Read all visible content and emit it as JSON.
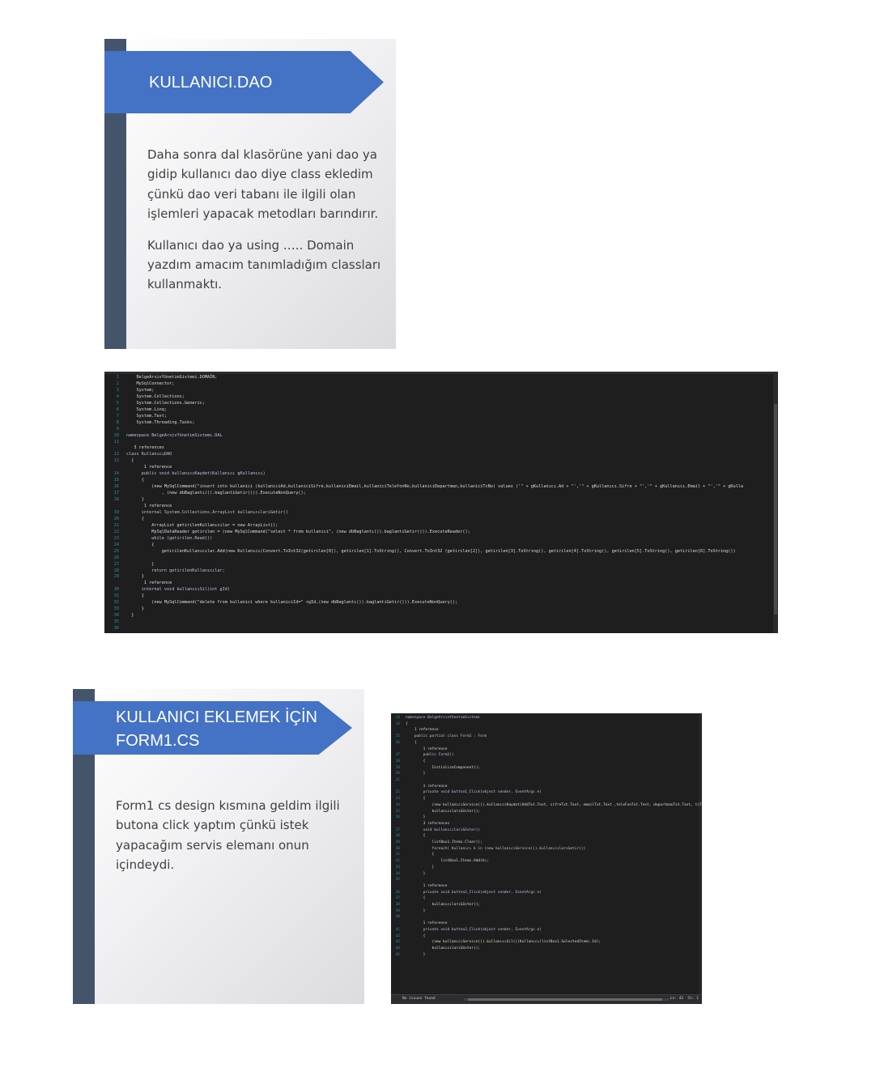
{
  "slide1": {
    "title": "KULLANICI.DAO",
    "paragraph1": "Daha sonra dal klasörüne yani dao ya gidip kullanıcı dao diye class ekledim çünkü dao veri tabanı ile ilgili olan işlemleri yapacak metodları barındırır.",
    "paragraph2": "Kullanıcı dao ya using ….. Domain yazdım amacım tanımladığım classları kullanmaktı."
  },
  "slide2": {
    "title": "KULLANICI EKLEMEK İÇİN FORM1.CS",
    "paragraph1": "Form1 cs design kısmına geldim ilgili butona click yaptım çünkü istek yapacağım servis elemanı onun içindeydi."
  },
  "code1": {
    "lines": [
      {
        "n": "1",
        "text": "    BelgeArsivYönetimSistemi.DOMAİN;"
      },
      {
        "n": "2",
        "text": "    MySqlConnector;"
      },
      {
        "n": "3",
        "text": "    System;"
      },
      {
        "n": "4",
        "text": "    System.Collections;"
      },
      {
        "n": "5",
        "text": "    System.Collections.Generic;"
      },
      {
        "n": "6",
        "text": "    System.Linq;"
      },
      {
        "n": "7",
        "text": "    System.Text;"
      },
      {
        "n": "8",
        "text": "    System.Threading.Tasks;"
      },
      {
        "n": "9",
        "text": ""
      },
      {
        "n": "10",
        "text": "namespace BelgeArsivYönetimSistemi.DAL"
      },
      {
        "n": "11",
        "text": ""
      },
      {
        "n": "",
        "text": "   3 references"
      },
      {
        "n": "12",
        "text": "class KullanıcıDAO"
      },
      {
        "n": "13",
        "text": "  {"
      },
      {
        "n": "",
        "text": "       1 reference"
      },
      {
        "n": "14",
        "text": "      public void kullanıcıKaydet(Kullanıcı gKullanıcı)"
      },
      {
        "n": "15",
        "text": "      {"
      },
      {
        "n": "16",
        "text": "          (new MySqlCommand(\"insert into kullanici (kullaniciAd,kullaniciSifre,kullaniciEmail,kullaniciTelefonNo,kullaniciDepartman,kullaniciTcNo) values ('\" + gKullanıcı.Ad + \"','\" + gKullanıcı.Sifre + \"','\" + gKullanıcı.Email + \"','\" + gKulla"
      },
      {
        "n": "17",
        "text": "              , (new dbBaglantı()).baglantiGetir())).ExecuteNonQuery();"
      },
      {
        "n": "18",
        "text": "      }"
      },
      {
        "n": "",
        "text": "       1 reference"
      },
      {
        "n": "19",
        "text": "      internal System.Collections.ArrayList kullanıcılarıGetir()"
      },
      {
        "n": "20",
        "text": "      {"
      },
      {
        "n": "21",
        "text": "          ArrayList getirilenKullanıcılar = new ArrayList();"
      },
      {
        "n": "22",
        "text": "          MySqlDataReader getirilen = (new MySqlCommand(\"select * from kullanici\", (new dbBaglantı()).baglantiGetir())).ExecuteReader();"
      },
      {
        "n": "23",
        "text": "          while (getirilen.Read())"
      },
      {
        "n": "24",
        "text": "          {"
      },
      {
        "n": "25",
        "text": "              getirilenKullanıcılar.Add(new Kullanıcı(Convert.ToInt32(getirilen[0]), getirilen[1].ToString(), Convert.ToInt32 (getirilen[2]), getirilen[3].ToString(), getirilen[4].ToString(), getirilen[5].ToString(), getirilen[6].ToString())"
      },
      {
        "n": "26",
        "text": ""
      },
      {
        "n": "27",
        "text": "          }"
      },
      {
        "n": "28",
        "text": "          return getirilenKullanıcılar;"
      },
      {
        "n": "29",
        "text": "      }"
      },
      {
        "n": "",
        "text": "       1 reference"
      },
      {
        "n": "30",
        "text": "      internal void kullanıcıSil(int gId)"
      },
      {
        "n": "31",
        "text": "      {"
      },
      {
        "n": "32",
        "text": "          (new MySqlCommand(\"delete from kullanici where kullaniciId=\" +gId,(new dbBaglantı()).baglantiGetir())).ExecuteNonQuery();"
      },
      {
        "n": "33",
        "text": "      }"
      },
      {
        "n": "34",
        "text": "  }"
      },
      {
        "n": "35",
        "text": ""
      },
      {
        "n": "36",
        "text": ""
      }
    ]
  },
  "code2": {
    "lines": [
      {
        "n": "13",
        "text": "namespace BelgeArsivYönetimSistemi"
      },
      {
        "n": "14",
        "text": "{"
      },
      {
        "n": "",
        "text": "    1 reference"
      },
      {
        "n": "15",
        "text": "    public partial class Form1 : Form"
      },
      {
        "n": "16",
        "text": "    {"
      },
      {
        "n": "",
        "text": "        1 reference"
      },
      {
        "n": "17",
        "text": "        public Form1()"
      },
      {
        "n": "18",
        "text": "        {"
      },
      {
        "n": "19",
        "text": "            InitializeComponent();"
      },
      {
        "n": "20",
        "text": "        }"
      },
      {
        "n": "21",
        "text": ""
      },
      {
        "n": "",
        "text": "        1 reference"
      },
      {
        "n": "22",
        "text": "        private void button1_Click(object sender, EventArgs e)"
      },
      {
        "n": "23",
        "text": "        {"
      },
      {
        "n": "24",
        "text": "            (new kullanıcıService()).kullanıcıKaydet(AddTxt.Text, sifreTxt.Text, emailTxt.Text ,teleFonTxt.Text, departmanTxt.Text, tcTxt.Text);"
      },
      {
        "n": "25",
        "text": "            kullanıcılarıGöster();"
      },
      {
        "n": "26",
        "text": "        }"
      },
      {
        "n": "",
        "text": "        3 references"
      },
      {
        "n": "27",
        "text": "        void kullanıcılarıGöster()"
      },
      {
        "n": "28",
        "text": "        {"
      },
      {
        "n": "29",
        "text": "            listBox1.Items.Clear();"
      },
      {
        "n": "30",
        "text": "            foreach( Kullanıcı k in (new kullanıcıService()).kullanıcılarıGetir())"
      },
      {
        "n": "31",
        "text": "            {"
      },
      {
        "n": "32",
        "text": "                listBox1.Items.Add(k);"
      },
      {
        "n": "33",
        "text": "            }"
      },
      {
        "n": "34",
        "text": "        }"
      },
      {
        "n": "35",
        "text": ""
      },
      {
        "n": "",
        "text": "        1 reference"
      },
      {
        "n": "36",
        "text": "        private void button2_Click(object sender, EventArgs e)"
      },
      {
        "n": "37",
        "text": "        {"
      },
      {
        "n": "38",
        "text": "            kullanıcılarıGöster();"
      },
      {
        "n": "39",
        "text": "        }"
      },
      {
        "n": "40",
        "text": ""
      },
      {
        "n": "",
        "text": "        1 reference"
      },
      {
        "n": "41",
        "text": "        private void button3_Click(object sender, EventArgs e)"
      },
      {
        "n": "42",
        "text": "        {"
      },
      {
        "n": "43",
        "text": "            (new kullanıcıService()).kullanıcıSil(((Kullanıcı)listBox1.SelectedItem).Id);"
      },
      {
        "n": "44",
        "text": "            kullanıcılarıGöster();"
      },
      {
        "n": "45",
        "text": "        }"
      }
    ],
    "status_left": "No issues found",
    "status_right": "Ln: 43  Ch: 1"
  }
}
